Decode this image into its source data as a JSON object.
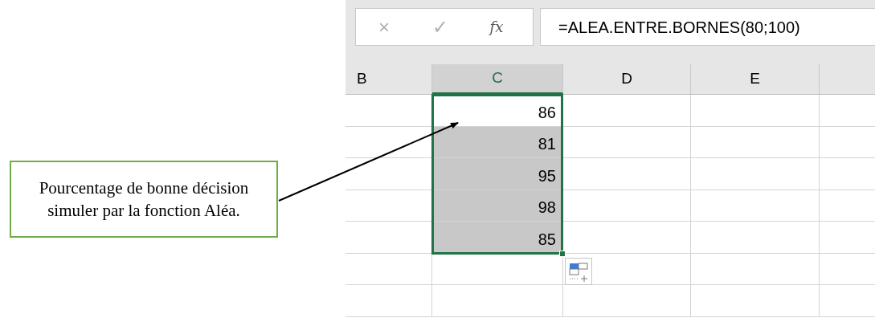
{
  "formula_bar": {
    "cancel": "×",
    "enter": "✓",
    "function": "fx",
    "formula": "=ALEA.ENTRE.BORNES(80;100)"
  },
  "columns": [
    {
      "label": "B",
      "selected": false
    },
    {
      "label": "C",
      "selected": true
    },
    {
      "label": "D",
      "selected": false
    },
    {
      "label": "E",
      "selected": false
    }
  ],
  "rows": [
    {
      "value": "86",
      "selected": true,
      "active": true
    },
    {
      "value": "81",
      "selected": true,
      "active": false
    },
    {
      "value": "95",
      "selected": true,
      "active": false
    },
    {
      "value": "98",
      "selected": true,
      "active": false
    },
    {
      "value": "85",
      "selected": true,
      "active": false
    }
  ],
  "callout": {
    "text": "Pourcentage de bonne décision simuler par la fonction Aléa."
  }
}
